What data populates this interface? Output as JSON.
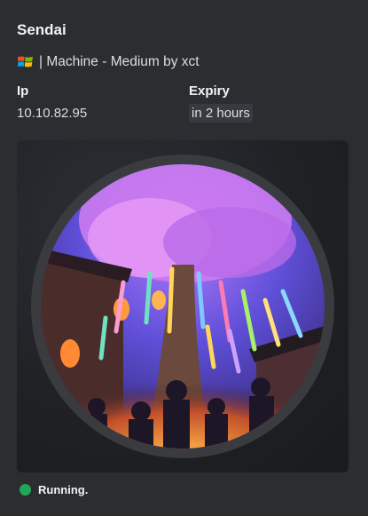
{
  "embed": {
    "title": "Sendai",
    "subtitle": "| Machine - Medium by xct",
    "os_icon": "windows-logo-icon",
    "fields": [
      {
        "name": "Ip",
        "value": "10.10.82.95"
      },
      {
        "name": "Expiry",
        "value": "in 2 hours"
      }
    ],
    "image_subject": "festival-street-illustration",
    "status": "Running.",
    "status_color": "#23a55a"
  },
  "colors": {
    "background": "#2b2d31",
    "text": "#dbdee1",
    "heading": "#f2f3f5",
    "code_bg": "#383a40"
  }
}
